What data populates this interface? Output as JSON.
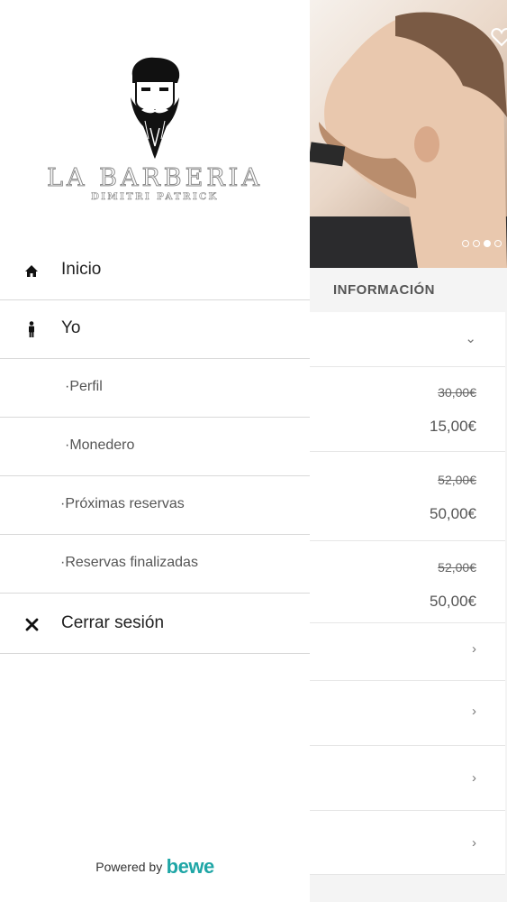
{
  "drawer": {
    "brand": {
      "title": "LA BARBERIA",
      "subtitle": "DIMITRI PATRICK"
    },
    "menu": [
      {
        "label": "Inicio",
        "icon": "home-icon"
      },
      {
        "label": "Yo",
        "icon": "person-icon"
      },
      {
        "label": "·Perfil"
      },
      {
        "label": "·Monedero"
      },
      {
        "label": "·Próximas reservas"
      },
      {
        "label": "·Reservas finalizadas"
      },
      {
        "label": "Cerrar sesión",
        "icon": "close-icon"
      }
    ],
    "footer": {
      "powered_by": "Powered by",
      "brand": "bewe"
    }
  },
  "background": {
    "section_title": "INFORMACIÓN",
    "carousel": {
      "slides": 4,
      "active": 3
    },
    "services": [
      {
        "old_price": "30,00€",
        "price": "15,00€"
      },
      {
        "old_price": "52,00€",
        "price": "50,00€"
      },
      {
        "old_price": "52,00€",
        "price": "50,00€"
      }
    ]
  },
  "colors": {
    "accent": "#1fa6a6",
    "divider": "#d9d9d9"
  }
}
